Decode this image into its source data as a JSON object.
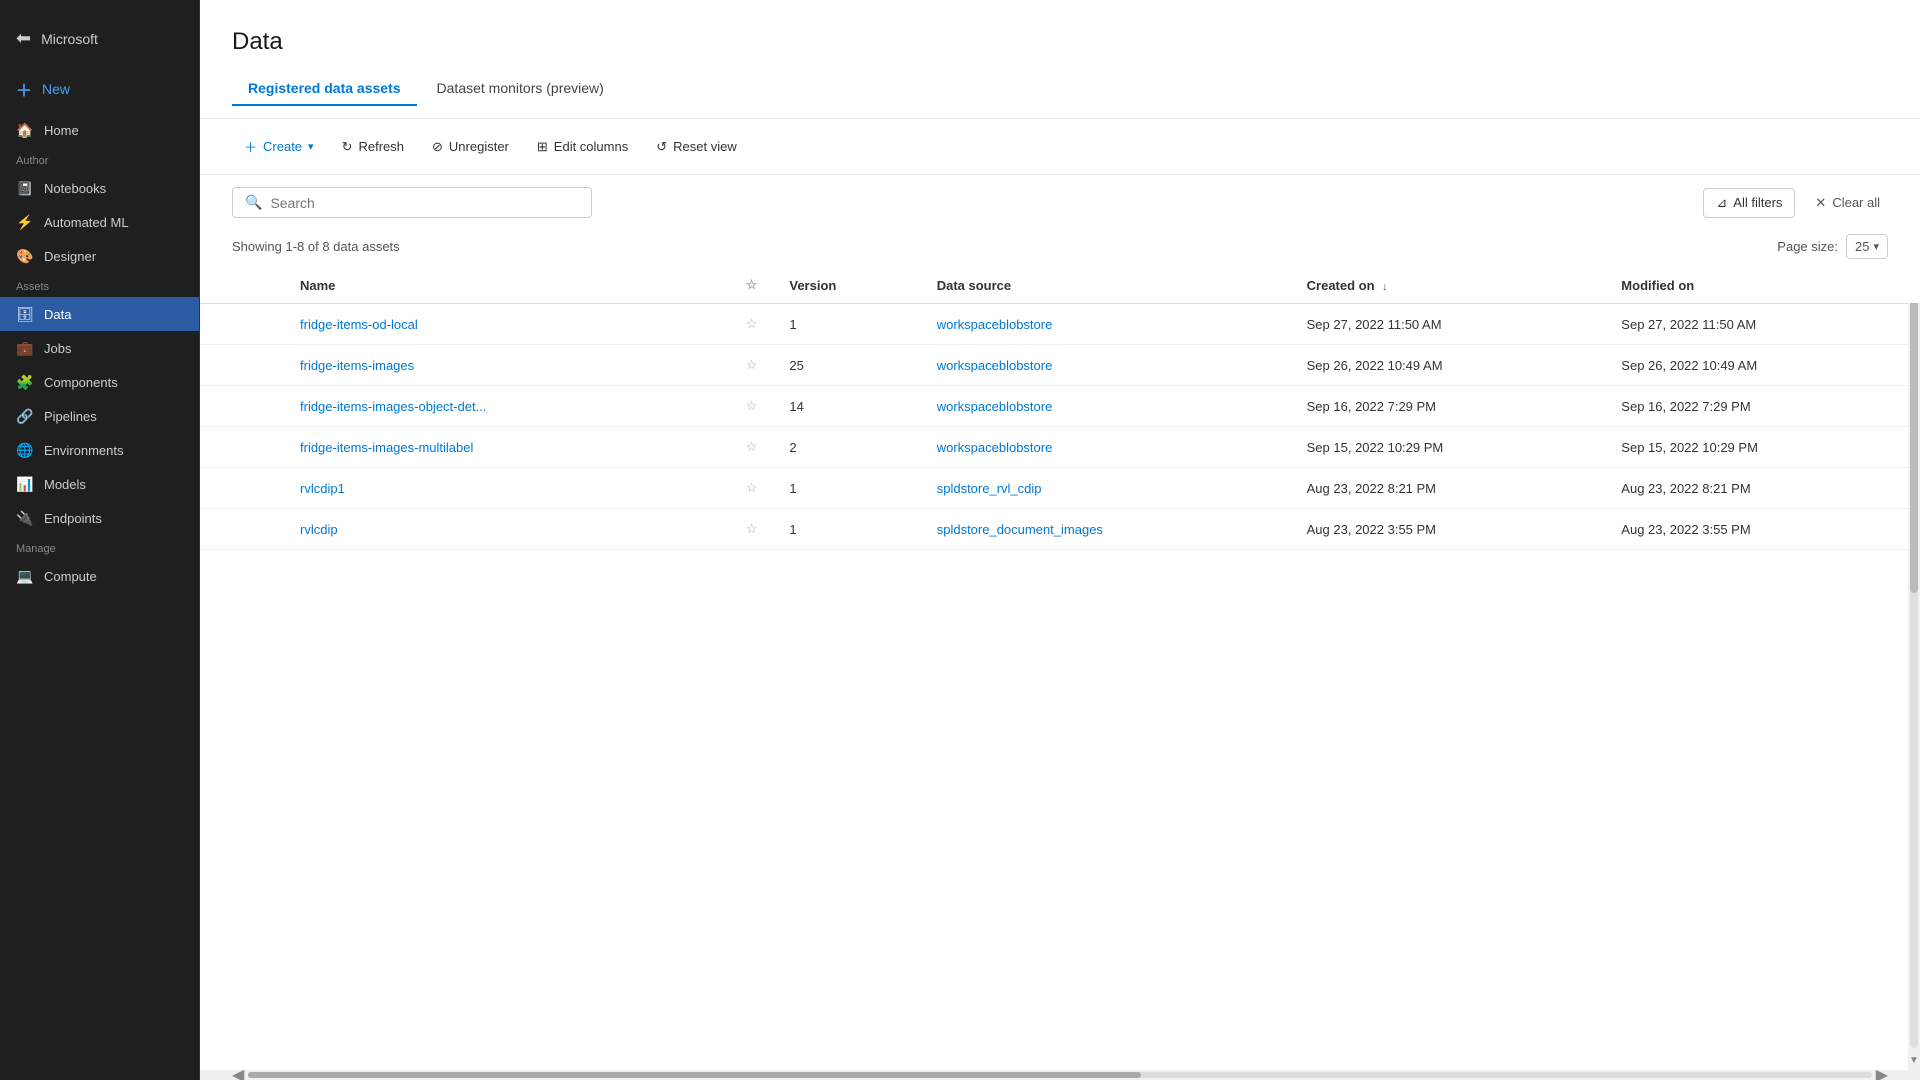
{
  "sidebar": {
    "logo_label": "Microsoft",
    "new_label": "New",
    "items": [
      {
        "id": "home",
        "label": "Home",
        "icon": "🏠",
        "active": false,
        "section": null
      },
      {
        "id": "notebooks",
        "label": "Notebooks",
        "icon": "📓",
        "active": false,
        "section": "Author"
      },
      {
        "id": "automated-ml",
        "label": "Automated ML",
        "icon": "⚡",
        "active": false,
        "section": null
      },
      {
        "id": "designer",
        "label": "Designer",
        "icon": "🎨",
        "active": false,
        "section": null
      },
      {
        "id": "data",
        "label": "Data",
        "icon": "🗄",
        "active": true,
        "section": "Assets"
      },
      {
        "id": "jobs",
        "label": "Jobs",
        "icon": "💼",
        "active": false,
        "section": null
      },
      {
        "id": "components",
        "label": "Components",
        "icon": "🧩",
        "active": false,
        "section": null
      },
      {
        "id": "pipelines",
        "label": "Pipelines",
        "icon": "🔗",
        "active": false,
        "section": null
      },
      {
        "id": "environments",
        "label": "Environments",
        "icon": "🌐",
        "active": false,
        "section": null
      },
      {
        "id": "models",
        "label": "Models",
        "icon": "📊",
        "active": false,
        "section": null
      },
      {
        "id": "endpoints",
        "label": "Endpoints",
        "icon": "🔌",
        "active": false,
        "section": null
      },
      {
        "id": "compute",
        "label": "Compute",
        "icon": "💻",
        "active": false,
        "section": "Manage"
      }
    ]
  },
  "page": {
    "title": "Data",
    "tabs": [
      {
        "id": "registered",
        "label": "Registered data assets",
        "active": true
      },
      {
        "id": "monitors",
        "label": "Dataset monitors (preview)",
        "active": false
      }
    ]
  },
  "toolbar": {
    "create_label": "Create",
    "refresh_label": "Refresh",
    "unregister_label": "Unregister",
    "edit_columns_label": "Edit columns",
    "reset_view_label": "Reset view"
  },
  "search": {
    "placeholder": "Search",
    "value": ""
  },
  "filters": {
    "all_filters_label": "All filters",
    "clear_all_label": "Clear all"
  },
  "table": {
    "showing_text": "Showing 1-8 of 8 data assets",
    "page_size_label": "Page size:",
    "page_size_value": "25",
    "columns": [
      {
        "id": "name",
        "label": "Name",
        "sortable": true,
        "sorted": false
      },
      {
        "id": "favorite",
        "label": "★",
        "sortable": false
      },
      {
        "id": "version",
        "label": "Version",
        "sortable": false
      },
      {
        "id": "datasource",
        "label": "Data source",
        "sortable": false
      },
      {
        "id": "created_on",
        "label": "Created on",
        "sortable": true,
        "sorted": true,
        "sort_dir": "desc"
      },
      {
        "id": "modified_on",
        "label": "Modified on",
        "sortable": false
      }
    ],
    "rows": [
      {
        "name": "fridge-items-od-local",
        "version": "1",
        "datasource": "workspaceblobstore",
        "created_on": "Sep 27, 2022 11:50 AM",
        "modified_on": "Sep 27, 2022 11:50 AM"
      },
      {
        "name": "fridge-items-images",
        "version": "25",
        "datasource": "workspaceblobstore",
        "created_on": "Sep 26, 2022 10:49 AM",
        "modified_on": "Sep 26, 2022 10:49 AM"
      },
      {
        "name": "fridge-items-images-object-det...",
        "version": "14",
        "datasource": "workspaceblobstore",
        "created_on": "Sep 16, 2022 7:29 PM",
        "modified_on": "Sep 16, 2022 7:29 PM"
      },
      {
        "name": "fridge-items-images-multilabel",
        "version": "2",
        "datasource": "workspaceblobstore",
        "created_on": "Sep 15, 2022 10:29 PM",
        "modified_on": "Sep 15, 2022 10:29 PM"
      },
      {
        "name": "rvlcdip1",
        "version": "1",
        "datasource": "spldstore_rvl_cdip",
        "created_on": "Aug 23, 2022 8:21 PM",
        "modified_on": "Aug 23, 2022 8:21 PM"
      },
      {
        "name": "rvlcdip",
        "version": "1",
        "datasource": "spldstore_document_images",
        "created_on": "Aug 23, 2022 3:55 PM",
        "modified_on": "Aug 23, 2022 3:55 PM"
      }
    ]
  }
}
